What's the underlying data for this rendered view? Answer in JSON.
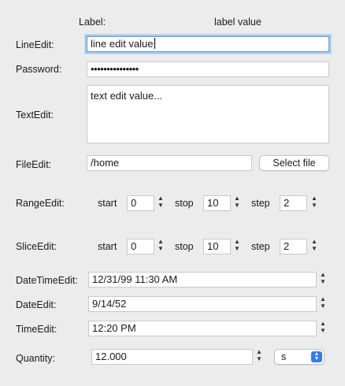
{
  "header": {
    "label_col": "Label:",
    "value_col": "label value"
  },
  "line_edit": {
    "label": "LineEdit:",
    "value": "line edit value"
  },
  "password": {
    "label": "Password:",
    "value": "•••••••••••••••"
  },
  "text_edit": {
    "label": "TextEdit:",
    "value": "text edit value..."
  },
  "file_edit": {
    "label": "FileEdit:",
    "value": "/home",
    "button": "Select file"
  },
  "range_edit": {
    "label": "RangeEdit:",
    "start_label": "start",
    "start": "0",
    "stop_label": "stop",
    "stop": "10",
    "step_label": "step",
    "step": "2"
  },
  "slice_edit": {
    "label": "SliceEdit:",
    "start_label": "start",
    "start": "0",
    "stop_label": "stop",
    "stop": "10",
    "step_label": "step",
    "step": "2"
  },
  "datetime_edit": {
    "label": "DateTimeEdit:",
    "value": "12/31/99 11:30 AM"
  },
  "date_edit": {
    "label": "DateEdit:",
    "value": "9/14/52"
  },
  "time_edit": {
    "label": "TimeEdit:",
    "value": "12:20 PM"
  },
  "quantity": {
    "label": "Quantity:",
    "value": "12.000",
    "unit": "s"
  },
  "icons": {
    "spin_up": "▲",
    "spin_down": "▼"
  },
  "colors": {
    "background": "#ececec",
    "focus_ring": "#a6c6ee",
    "accent": "#2f7bf6"
  }
}
